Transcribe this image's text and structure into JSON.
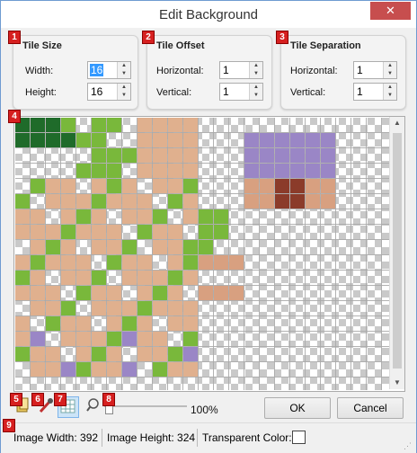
{
  "window": {
    "title": "Edit Background",
    "close": "✕"
  },
  "tile_size": {
    "title": "Tile Size",
    "width_label": "Width:",
    "width_value": "16",
    "height_label": "Height:",
    "height_value": "16"
  },
  "tile_offset": {
    "title": "Tile Offset",
    "horizontal_label": "Horizontal:",
    "horizontal_value": "1",
    "vertical_label": "Vertical:",
    "vertical_value": "1"
  },
  "tile_separation": {
    "title": "Tile Separation",
    "horizontal_label": "Horizontal:",
    "horizontal_value": "1",
    "vertical_label": "Vertical:",
    "vertical_value": "1"
  },
  "badges": [
    "1",
    "2",
    "3",
    "4",
    "5",
    "6",
    "7",
    "8",
    "9"
  ],
  "toolbar": {
    "zoom_label": "100%",
    "ok_label": "OK",
    "cancel_label": "Cancel"
  },
  "status": {
    "image_width": "Image Width: 392",
    "image_height": "Image Height: 324",
    "transparent_color": "Transparent Color:"
  },
  "colors": {
    "grass": "#79b83b",
    "dirt": "#e0b08e",
    "roof": "#9a86c6",
    "brick": "#d8a080",
    "door": "#8b3b2a",
    "tree": "#1f6b2a"
  },
  "icons": [
    "layer-icon",
    "eyedropper-icon",
    "grid-icon",
    "zoom-icon"
  ]
}
